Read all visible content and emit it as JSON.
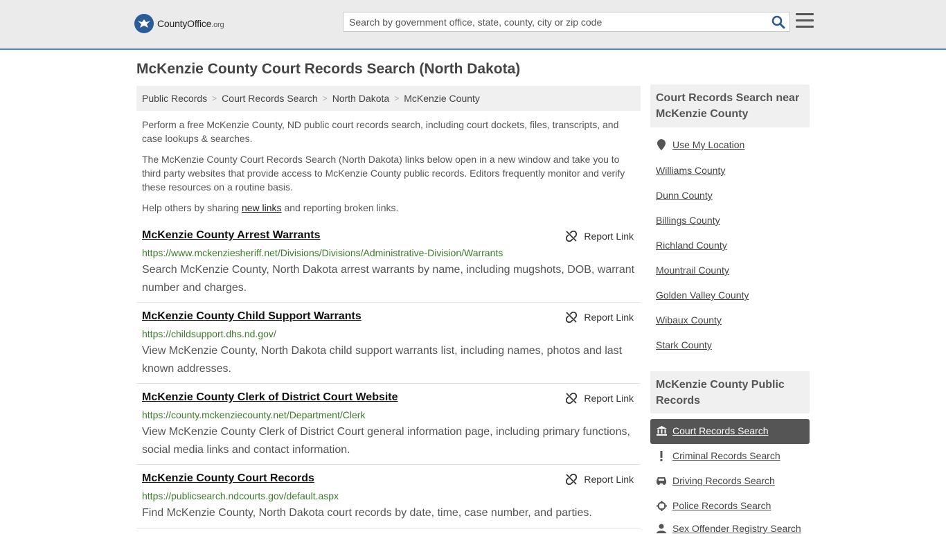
{
  "header": {
    "logo_main": "CountyOffice",
    "logo_tld": ".org",
    "search_placeholder": "Search by government office, state, county, city or zip code"
  },
  "page_title": "McKenzie County Court Records Search (North Dakota)",
  "breadcrumb": [
    "Public Records",
    "Court Records Search",
    "North Dakota",
    "McKenzie County"
  ],
  "intro": {
    "p1": "Perform a free McKenzie County, ND public court records search, including court dockets, files, transcripts, and case lookups & searches.",
    "p2": "The McKenzie County Court Records Search (North Dakota) links below open in a new window and take you to third party websites that provide access to McKenzie County public records. Editors frequently monitor and verify these resources on a routine basis.",
    "p3_before": "Help others by sharing ",
    "p3_link": "new links",
    "p3_after": " and reporting broken links."
  },
  "report_label": "Report Link",
  "results": [
    {
      "title": "McKenzie County Arrest Warrants",
      "url": "https://www.mckenziesheriff.net/Divisions/Divisions/Administrative-Division/Warrants",
      "desc": "Search McKenzie County, North Dakota arrest warrants by name, including mugshots, DOB, warrant number and charges."
    },
    {
      "title": "McKenzie County Child Support Warrants",
      "url": "https://childsupport.dhs.nd.gov/",
      "desc": "View McKenzie County, North Dakota child support warrants list, including names, photos and last known addresses."
    },
    {
      "title": "McKenzie County Clerk of District Court Website",
      "url": "https://county.mckenziecounty.net/Department/Clerk",
      "desc": "View McKenzie County Clerk of District Court general information page, including primary functions, social media links and contact information."
    },
    {
      "title": "McKenzie County Court Records",
      "url": "https://publicsearch.ndcourts.gov/default.aspx",
      "desc": "Find McKenzie County, North Dakota court records by date, time, case number, and parties."
    }
  ],
  "sidebar": {
    "nearby_title": "Court Records Search near McKenzie County",
    "use_location": "Use My Location",
    "nearby": [
      "Williams County",
      "Dunn County",
      "Billings County",
      "Richland County",
      "Mountrail County",
      "Golden Valley County",
      "Wibaux County",
      "Stark County"
    ],
    "public_title": "McKenzie County Public Records",
    "public_links": [
      {
        "label": "Court Records Search",
        "icon": "courthouse-icon",
        "active": true
      },
      {
        "label": "Criminal Records Search",
        "icon": "exclamation-icon",
        "active": false
      },
      {
        "label": "Driving Records Search",
        "icon": "car-icon",
        "active": false
      },
      {
        "label": "Police Records Search",
        "icon": "crosshair-icon",
        "active": false
      },
      {
        "label": "Sex Offender Registry Search",
        "icon": "user-icon",
        "active": false
      }
    ]
  }
}
